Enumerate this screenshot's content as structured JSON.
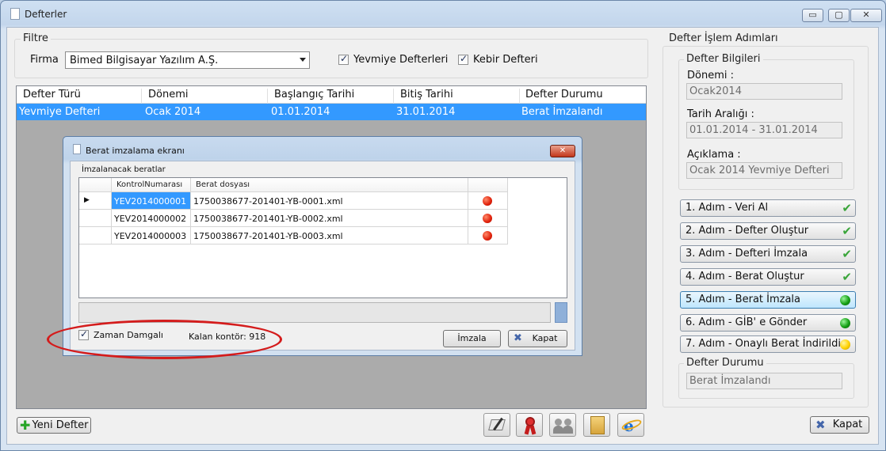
{
  "window": {
    "title": "Defterler",
    "min": "▭",
    "max": "▢",
    "close": "✕"
  },
  "filter": {
    "group_title": "Filtre",
    "firma_label": "Firma",
    "firma_value": "Bimed Bilgisayar Yazılım A.Ş.",
    "yevmiye_label": "Yevmiye Defterleri",
    "kebir_label": "Kebir Defteri"
  },
  "grid": {
    "columns": [
      "Defter Türü",
      "Dönemi",
      "Başlangıç Tarihi",
      "Bitiş Tarihi",
      "Defter Durumu"
    ],
    "rows": [
      [
        "Yevmiye Defteri",
        "Ocak 2014",
        "01.01.2014",
        "31.01.2014",
        "Berat İmzalandı"
      ]
    ]
  },
  "dialog": {
    "title": "Berat imzalama ekranı",
    "list_label": "İmzalanacak beratlar",
    "columns": [
      "KontrolNumarası",
      "Berat dosyası"
    ],
    "rows": [
      {
        "control": "YEV2014000001",
        "file": "1750038677-201401-YB-0001.xml",
        "current": true
      },
      {
        "control": "YEV2014000002",
        "file": "1750038677-201401-YB-0002.xml",
        "current": false
      },
      {
        "control": "YEV2014000003",
        "file": "1750038677-201401-YB-0003.xml",
        "current": false
      }
    ],
    "timestamp_label": "Zaman Damgalı",
    "remaining_label": "Kalan kontör: 918",
    "sign_button": "İmzala",
    "close_button": "Kapat"
  },
  "steps_panel": {
    "group_title": "Defter İşlem Adımları",
    "info_title": "Defter Bilgileri",
    "donemi_label": "Dönemi :",
    "donemi_value": "Ocak2014",
    "tarih_label": "Tarih Aralığı :",
    "tarih_value": "01.01.2014 - 31.01.2014",
    "aciklama_label": "Açıklama :",
    "aciklama_value": "Ocak 2014 Yevmiye Defteri",
    "steps": [
      {
        "label": "1. Adım - Veri Al",
        "status": "done"
      },
      {
        "label": "2. Adım - Defter Oluştur",
        "status": "done"
      },
      {
        "label": "3. Adım - Defteri İmzala",
        "status": "done"
      },
      {
        "label": "4. Adım - Berat Oluştur",
        "status": "done"
      },
      {
        "label": "5. Adım - Berat İmzala",
        "status": "ready"
      },
      {
        "label": "6. Adım - GİB' e Gönder",
        "status": "ready"
      },
      {
        "label": "7. Adım - Onaylı Berat İndirildi",
        "status": "pending"
      }
    ],
    "durum_title": "Defter Durumu",
    "durum_value": "Berat İmzalandı"
  },
  "footer": {
    "new_button": "Yeni Defter",
    "close_button": "Kapat"
  }
}
